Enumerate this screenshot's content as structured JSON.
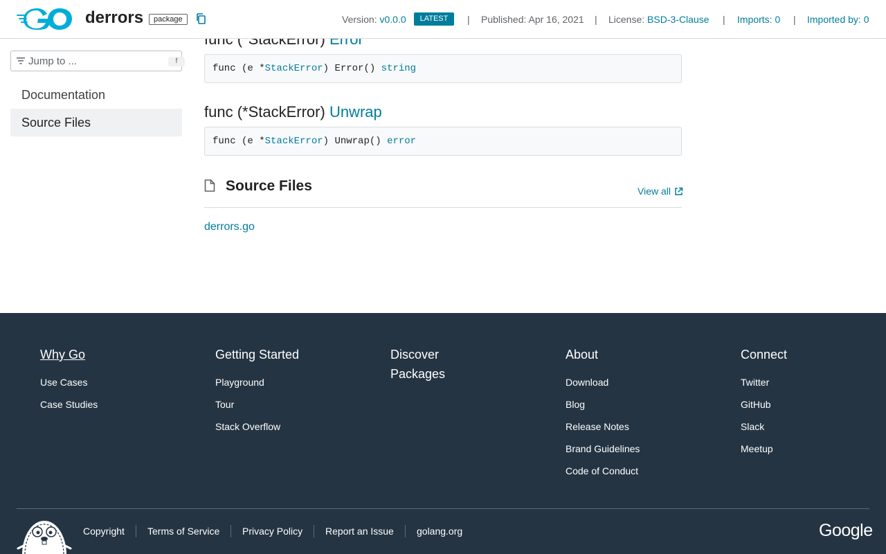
{
  "header": {
    "package_name": "derrors",
    "badge": "package",
    "version_label": "Version:",
    "version_value": "v0.0.0",
    "latest_label": "LATEST",
    "separator": "|",
    "published_label": "Published: Apr 16, 2021",
    "license_label": "License:",
    "license_value": "BSD-3-Clause",
    "imports_label": "Imports: 0",
    "imported_by_label": "Imported by: 0",
    "brand_color": "#00ADD8",
    "link_color": "#007d9c"
  },
  "sidebar": {
    "search_placeholder": "Jump to ...",
    "search_shortcut": "f",
    "items": [
      {
        "label": "Documentation",
        "active": false
      },
      {
        "label": "Source Files",
        "active": true
      }
    ]
  },
  "main": {
    "funcs": [
      {
        "prefix": "func (*StackError) ",
        "name": "Error",
        "code_pre": "func (e *",
        "code_type": "StackError",
        "code_mid": ") Error() ",
        "code_ret": "string"
      },
      {
        "prefix": "func (*StackError) ",
        "name": "Unwrap",
        "code_pre": "func (e *",
        "code_type": "StackError",
        "code_mid": ") Unwrap() ",
        "code_ret": "error"
      }
    ],
    "source_files": {
      "title": "Source Files",
      "view_all": "View all",
      "files": [
        "derrors.go"
      ]
    }
  },
  "footer": {
    "columns": [
      {
        "heading": "Why Go",
        "links": [
          "Use Cases",
          "Case Studies"
        ]
      },
      {
        "heading": "Getting Started",
        "links": [
          "Playground",
          "Tour",
          "Stack Overflow"
        ]
      },
      {
        "heading": "Discover Packages",
        "links": []
      },
      {
        "heading": "About",
        "links": [
          "Download",
          "Blog",
          "Release Notes",
          "Brand Guidelines",
          "Code of Conduct"
        ]
      },
      {
        "heading": "Connect",
        "links": [
          "Twitter",
          "GitHub",
          "Slack",
          "Meetup"
        ]
      }
    ],
    "bottom_links": [
      "Copyright",
      "Terms of Service",
      "Privacy Policy",
      "Report an Issue",
      "golang.org"
    ],
    "google_label": "Google",
    "background": "#253443"
  }
}
